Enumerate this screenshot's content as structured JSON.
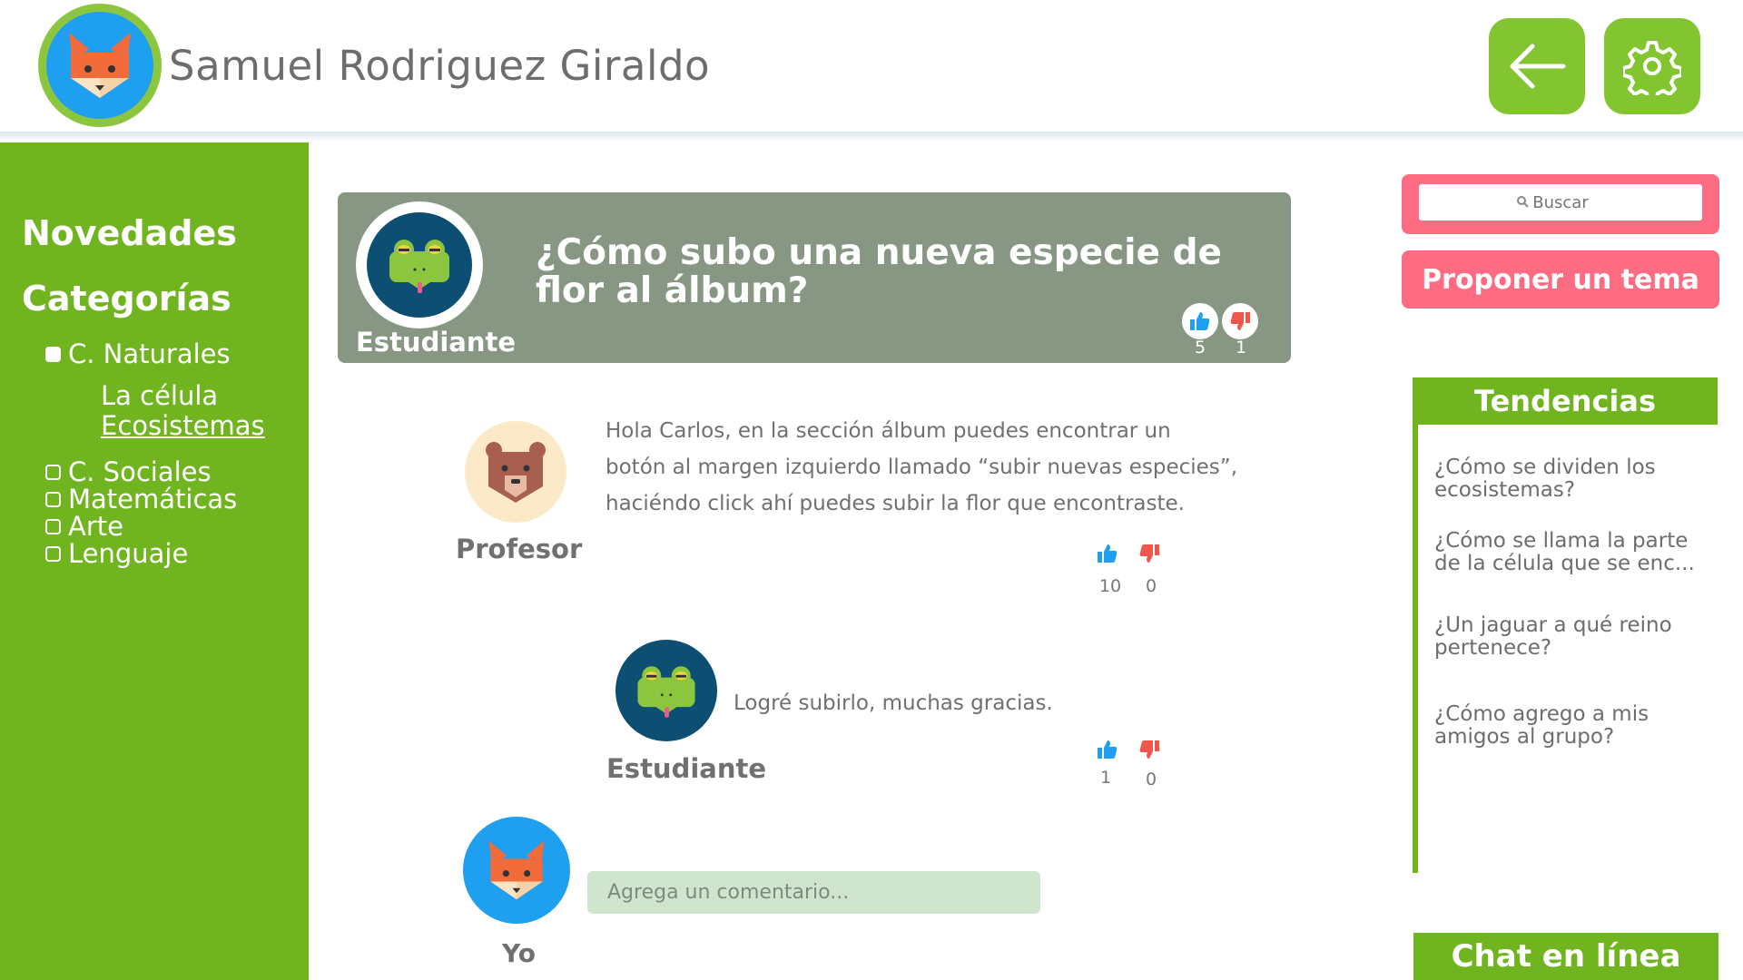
{
  "header": {
    "user_name": "Samuel Rodriguez Giraldo",
    "back_icon": "arrow-left-icon",
    "settings_icon": "gear-icon"
  },
  "sidebar": {
    "novedades": "Novedades",
    "categorias": "Categorías",
    "categories": [
      {
        "label": "C. Naturales",
        "checked": true
      },
      {
        "label": "C. Sociales",
        "checked": false
      },
      {
        "label": "Matemáticas",
        "checked": false
      },
      {
        "label": "Arte",
        "checked": false
      },
      {
        "label": "Lenguaje",
        "checked": false
      }
    ],
    "subtopics": [
      "La célula",
      "Ecosistemas"
    ]
  },
  "question": {
    "role": "Estudiante",
    "text": "¿Cómo subo una nueva especie de flor al álbum?",
    "likes": "5",
    "dislikes": "1"
  },
  "replies": [
    {
      "role": "Profesor",
      "lines": [
        "Hola Carlos, en la sección álbum puedes encontrar un",
        "botón al margen izquierdo llamado “subir nuevas especies”,",
        "haciéndo click ahí puedes subir la flor que encontraste."
      ],
      "likes": "10",
      "dislikes": "0"
    },
    {
      "role": "Estudiante",
      "text": "Logré subirlo, muchas gracias.",
      "likes": "1",
      "dislikes": "0"
    }
  ],
  "composer": {
    "role": "Yo",
    "placeholder": "Agrega un comentario..."
  },
  "right": {
    "search_placeholder": "Buscar",
    "propose_label": "Proponer un tema",
    "trends_title": "Tendencias",
    "trends": [
      "¿Cómo se dividen los ecosistemas?",
      "¿Cómo se llama la parte de la célula que se enc...",
      "¿Un jaguar a qué reino pertenece?",
      "¿Cómo agrego a mis amigos al grupo?"
    ],
    "chat_title": "Chat en línea"
  },
  "colors": {
    "green": "#70b51f",
    "button_green": "#82c531",
    "pink": "#fd6c82",
    "card_gray": "#879784",
    "like_blue": "#1f9ff0",
    "dislike_red": "#f0564a"
  }
}
